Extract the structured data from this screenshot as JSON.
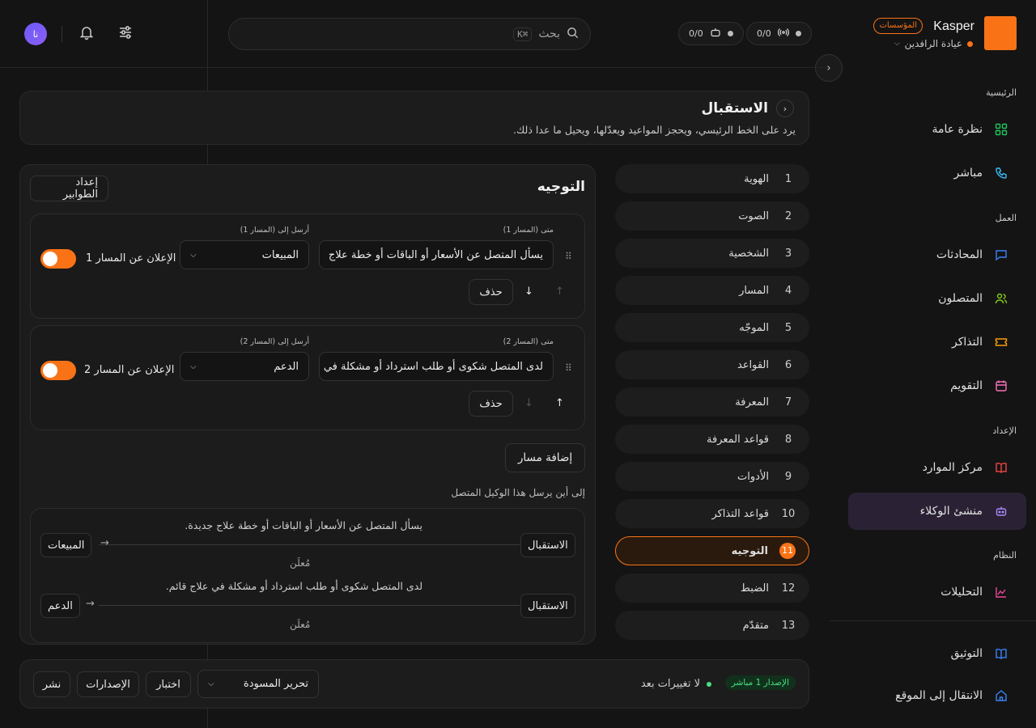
{
  "brand": {
    "name": "Kasper",
    "plan_badge": "المؤسسات",
    "workspace": "عيادة الرافدين"
  },
  "topbar": {
    "search_placeholder": "بحث",
    "search_shortcut": "⌘K",
    "pill_calls": "0/0",
    "pill_agents": "0/0",
    "avatar_initials": "نا"
  },
  "sidebar": {
    "sections": [
      {
        "label": "الرئيسية",
        "items": [
          {
            "label": "نظرة عامة",
            "icon": "grid-icon"
          },
          {
            "label": "مباشر",
            "icon": "phone-icon"
          }
        ]
      },
      {
        "label": "العمل",
        "items": [
          {
            "label": "المحادثات",
            "icon": "chat-icon"
          },
          {
            "label": "المتصلون",
            "icon": "users-icon"
          },
          {
            "label": "التذاكر",
            "icon": "ticket-icon"
          },
          {
            "label": "التقويم",
            "icon": "calendar-icon"
          }
        ]
      },
      {
        "label": "الإعداد",
        "items": [
          {
            "label": "مركز الموارد",
            "icon": "book-icon"
          },
          {
            "label": "منشئ الوكلاء",
            "icon": "bot-icon"
          }
        ]
      },
      {
        "label": "النظام",
        "items": [
          {
            "label": "التحليلات",
            "icon": "chart-icon"
          }
        ]
      }
    ],
    "footer": [
      {
        "label": "التوثيق",
        "icon": "doc-icon"
      },
      {
        "label": "الانتقال إلى الموقع",
        "icon": "home-icon"
      }
    ]
  },
  "header_card": {
    "title": "الاستقبال",
    "description": "يرد على الخط الرئيسي، ويحجز المواعيد ويعدّلها، ويحيل ما عدا ذلك."
  },
  "steps": [
    {
      "num": "1",
      "label": "الهوية"
    },
    {
      "num": "2",
      "label": "الصوت"
    },
    {
      "num": "3",
      "label": "الشخصية"
    },
    {
      "num": "4",
      "label": "المسار"
    },
    {
      "num": "5",
      "label": "الموجّه"
    },
    {
      "num": "6",
      "label": "القواعد"
    },
    {
      "num": "7",
      "label": "المعرفة"
    },
    {
      "num": "8",
      "label": "قواعد المعرفة"
    },
    {
      "num": "9",
      "label": "الأدوات"
    },
    {
      "num": "10",
      "label": "قواعد التذاكر"
    },
    {
      "num": "11",
      "label": "التوجيه"
    },
    {
      "num": "12",
      "label": "الضبط"
    },
    {
      "num": "13",
      "label": "متقدّم"
    }
  ],
  "routing": {
    "title": "التوجيه",
    "queues_button": "إعداد الطوابير",
    "routes": [
      {
        "when_label": "متى (المسار 1)",
        "send_label": "أرسل إلى (المسار 1)",
        "condition": "يسأل المتصل عن الأسعار أو الباقات أو خطة علاج",
        "target": "المبيعات",
        "announce_label": "الإعلان عن المسار 1",
        "delete": "حذف"
      },
      {
        "when_label": "متى (المسار 2)",
        "send_label": "أرسل إلى (المسار 2)",
        "condition": "لدى المتصل شكوى أو طلب استرداد أو مشكلة في",
        "target": "الدعم",
        "announce_label": "الإعلان عن المسار 2",
        "delete": "حذف"
      }
    ],
    "add_route": "إضافة مسار",
    "map_title": "إلى أين يرسل هذا الوكيل المتصل",
    "map": [
      {
        "source": "الاستقبال",
        "condition": "يسأل المتصل عن الأسعار أو الباقات أو خطة علاج جديدة.",
        "target": "المبيعات",
        "status": "مُعلَن"
      },
      {
        "source": "الاستقبال",
        "condition": "لدى المتصل شكوى أو طلب استرداد أو مشكلة في علاج قائم.",
        "target": "الدعم",
        "status": "مُعلَن"
      }
    ]
  },
  "footer_bar": {
    "version_badge": "الإصدار 1 مباشر",
    "status": "لا تغييرات بعد",
    "mode_select": "تحرير المسودة",
    "test": "اختبار",
    "versions": "الإصدارات",
    "publish": "نشر"
  },
  "colors": {
    "accent": "#f97316",
    "bg": "#141414",
    "card": "#1c1c1c"
  }
}
